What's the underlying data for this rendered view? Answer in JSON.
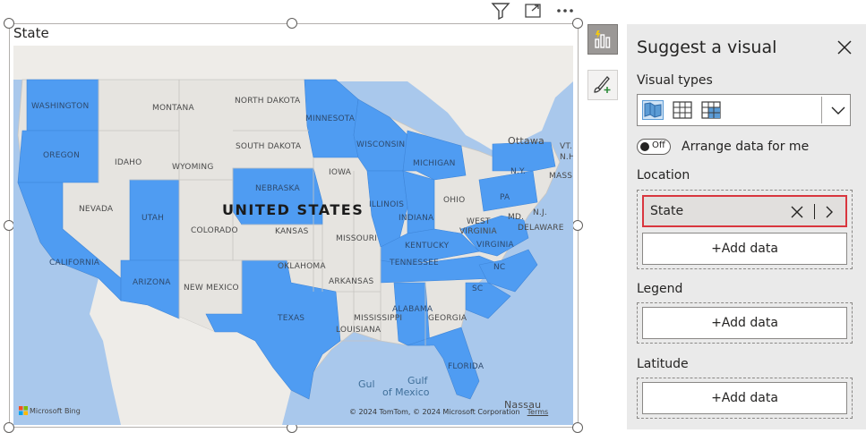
{
  "visual": {
    "title": "State",
    "header_icons": [
      "filter-icon",
      "focus-mode-icon",
      "more-options-icon"
    ],
    "map": {
      "country_label": "UNITED STATES",
      "highlight_color": "#4f9cf2",
      "highlighted_states": [
        "WASHINGTON",
        "OREGON",
        "CALIFORNIA",
        "ARIZONA",
        "UTAH",
        "NEBRASKA",
        "MINNESOTA",
        "WISCONSIN",
        "MICHIGAN",
        "ILLINOIS",
        "INDIANA",
        "KENTUCKY",
        "TENNESSEE",
        "VIRGINIA",
        "NC",
        "SC",
        "TEXAS",
        "ALABAMA",
        "FLORIDA",
        "PA",
        "N.Y."
      ],
      "labels": {
        "washington": "WASHINGTON",
        "oregon": "OREGON",
        "california": "CALIFORNIA",
        "nevada": "NEVADA",
        "idaho": "IDAHO",
        "montana": "MONTANA",
        "wyoming": "WYOMING",
        "utah": "UTAH",
        "arizona": "ARIZONA",
        "colorado": "COLORADO",
        "new_mexico": "NEW MEXICO",
        "north_dakota": "NORTH DAKOTA",
        "south_dakota": "SOUTH DAKOTA",
        "nebraska": "NEBRASKA",
        "kansas": "KANSAS",
        "oklahoma": "OKLAHOMA",
        "texas": "TEXAS",
        "minnesota": "MINNESOTA",
        "iowa": "IOWA",
        "missouri": "MISSOURI",
        "arkansas": "ARKANSAS",
        "louisiana": "LOUISIANA",
        "wisconsin": "WISCONSIN",
        "illinois": "ILLINOIS",
        "michigan": "MICHIGAN",
        "indiana": "INDIANA",
        "ohio": "OHIO",
        "kentucky": "KENTUCKY",
        "tennessee": "TENNESSEE",
        "mississippi": "MISSISSIPPI",
        "alabama": "ALABAMA",
        "georgia": "GEORGIA",
        "florida": "FLORIDA",
        "sc": "SC",
        "nc": "NC",
        "virginia": "VIRGINIA",
        "west_virginia_1": "WEST",
        "west_virginia_2": "VIRGINIA",
        "pa": "PA",
        "ny": "N.Y.",
        "md": "MD.",
        "nj": "N.J.",
        "delaware": "DELAWARE",
        "vt": "VT.",
        "nh": "N.H.",
        "mass": "MASS",
        "ottawa": "Ottawa",
        "nassau": "Nassau",
        "gulf_1": "Gulf",
        "gulf_2": "of Mexico",
        "gul": "Gul"
      },
      "attribution": "© 2024 TomTom, © 2024 Microsoft Corporation",
      "terms": "Terms",
      "bing": "Microsoft Bing"
    }
  },
  "pane": {
    "title": "Suggest a visual",
    "visual_types_label": "Visual types",
    "visual_type_icons": [
      "filled-map-icon",
      "table-icon",
      "matrix-icon"
    ],
    "toggle_state": "Off",
    "toggle_label": "Arrange data for me",
    "location_label": "Location",
    "location_field": "State",
    "add_data": "+Add data",
    "legend_label": "Legend",
    "latitude_label": "Latitude"
  }
}
